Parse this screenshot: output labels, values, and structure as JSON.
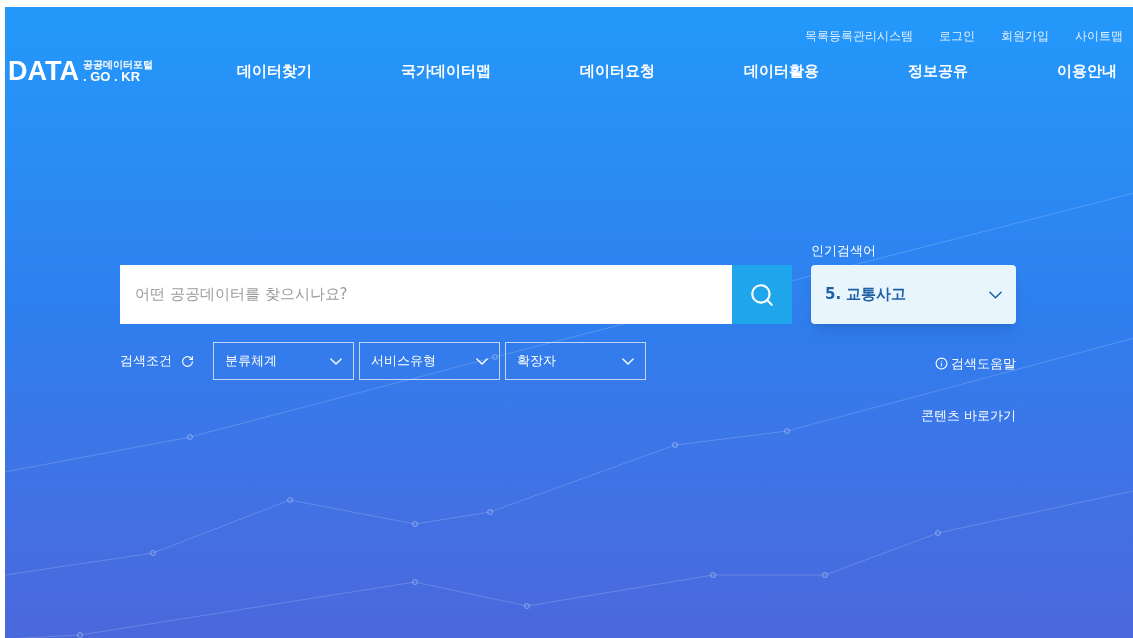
{
  "logo": {
    "main": "DATA",
    "sub_top": "공공데이터포털",
    "sub_bottom": ". GO . KR"
  },
  "utility_links": [
    "목록등록관리시스템",
    "로그인",
    "회원가입",
    "사이트맵"
  ],
  "nav": [
    "데이터찾기",
    "국가데이터맵",
    "데이터요청",
    "데이터활용",
    "정보공유",
    "이용안내"
  ],
  "search": {
    "placeholder": "어떤 공공데이터를 찾으시나요?"
  },
  "popular": {
    "label": "인기검색어",
    "current": "5. 교통사고"
  },
  "filters": {
    "label": "검색조건",
    "selects": [
      "분류체계",
      "서비스유형",
      "확장자"
    ]
  },
  "help_link": "검색도움말",
  "shortcut_link": "콘텐츠 바로가기"
}
